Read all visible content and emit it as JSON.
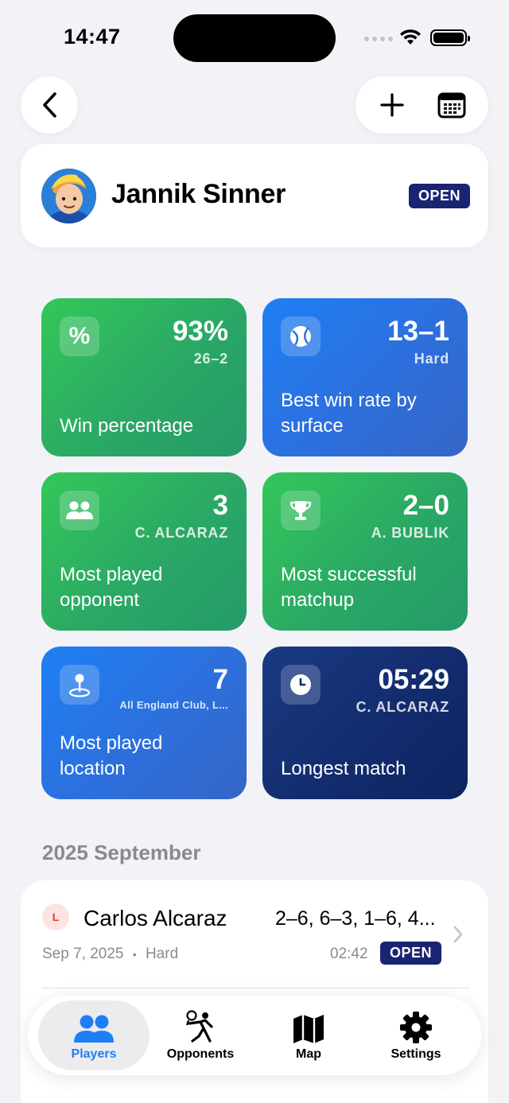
{
  "status": {
    "time": "14:47"
  },
  "player": {
    "name": "Jannik Sinner",
    "badge": "OPEN"
  },
  "stats": [
    {
      "big": "93%",
      "sub": "26–2",
      "label": "Win percentage",
      "icon": "percent-icon",
      "color": "green"
    },
    {
      "big": "13–1",
      "sub": "Hard",
      "label": "Best win rate by surface",
      "icon": "tennis-ball-icon",
      "color": "blue"
    },
    {
      "big": "3",
      "sub": "C. ALCARAZ",
      "label": "Most played opponent",
      "icon": "people-icon",
      "color": "green"
    },
    {
      "big": "2–0",
      "sub": "A. BUBLIK",
      "label": "Most successful matchup",
      "icon": "trophy-icon",
      "color": "green"
    },
    {
      "big": "7",
      "sub": "All England Club, L...",
      "label": "Most played location",
      "icon": "location-pin-icon",
      "color": "blue"
    },
    {
      "big": "05:29",
      "sub": "C. ALCARAZ",
      "label": "Longest match",
      "icon": "clock-icon",
      "color": "navy"
    }
  ],
  "section": {
    "title": "2025 September"
  },
  "matches": [
    {
      "result": "L",
      "opponent": "Carlos Alcaraz",
      "score": "2–6, 6–3, 1–6, 4...",
      "date": "Sep 7, 2025",
      "surface": "Hard",
      "separator": "•",
      "duration": "02:42",
      "badge": "OPEN"
    }
  ],
  "tabs": [
    {
      "label": "Players",
      "icon": "players-icon",
      "active": true
    },
    {
      "label": "Opponents",
      "icon": "opponents-icon",
      "active": false
    },
    {
      "label": "Map",
      "icon": "map-icon",
      "active": false
    },
    {
      "label": "Settings",
      "icon": "gear-icon",
      "active": false
    }
  ],
  "colors": {
    "green": "#34c759",
    "blue": "#1e7ff5",
    "navy": "#132c6e",
    "badge": "#1a2472",
    "accent": "#1e7ff5"
  }
}
